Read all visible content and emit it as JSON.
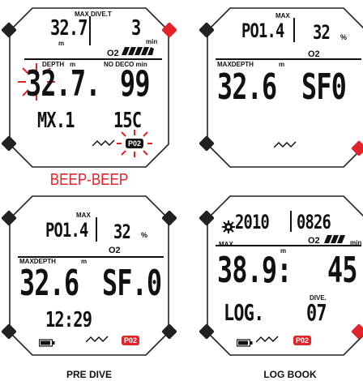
{
  "colors": {
    "accent": "#e2232a",
    "ink": "#111111"
  },
  "screens": {
    "alarm": {
      "max_dive_t_label": "MAX DIVE.T",
      "max_depth_value": "32.7",
      "dive_time_value": "3",
      "unit_m": "m",
      "unit_min": "min",
      "o2_label": "O2",
      "depth_label": "DEPTH",
      "depth_unit": "m",
      "no_deco_label": "NO DECO min",
      "depth_value": "32.7.",
      "no_deco_value": "99",
      "gas_label": "MX.1",
      "temp_value": "15C",
      "ppo2_badge": "P02",
      "alarm_text": "BEEP-BEEP"
    },
    "max_ppo2": {
      "max_label": "MAX",
      "po_value": "PO1.4",
      "o2_percent": "32",
      "percent_sign": "%",
      "o2_label": "O2",
      "maxdepth_label": "MAXDEPTH",
      "depth_unit": "m",
      "maxdepth_value": "32.6",
      "sf_value": "SF0"
    },
    "pre_dive": {
      "max_label": "MAX",
      "po_value": "PO1.4",
      "o2_percent": "32",
      "percent_sign": "%",
      "o2_label": "O2",
      "maxdepth_label": "MAXDEPTH",
      "depth_unit": "m",
      "maxdepth_value": "32.6",
      "sf_value": "SF.0",
      "time_value": "12:29",
      "ppo2_badge": "P02",
      "caption": "PRE DIVE"
    },
    "log_book": {
      "date_value": "2010",
      "date_md": "0826",
      "o2_label": "O2",
      "max_label": "MAX",
      "unit_m": "m",
      "unit_min": "min",
      "depth_value": "38.9:",
      "time_value": "45",
      "dive_label": "DIVE.",
      "log_label": "LOG.",
      "dive_no": "07",
      "ppo2_badge": "P02",
      "caption": "LOG BOOK"
    }
  }
}
